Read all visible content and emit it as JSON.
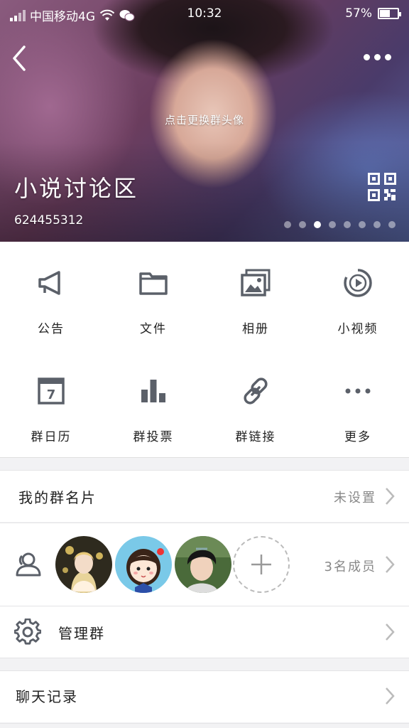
{
  "status_bar": {
    "carrier": "中国移动4G",
    "time": "10:32",
    "battery_percent": "57%",
    "battery_level": 0.57
  },
  "header": {
    "change_avatar_hint": "点击更换群头像",
    "group_name": "小说讨论区",
    "group_id": "624455312",
    "carousel_total": 8,
    "carousel_active": 3
  },
  "features": [
    {
      "label": "公告",
      "icon": "megaphone-icon"
    },
    {
      "label": "文件",
      "icon": "folder-icon"
    },
    {
      "label": "相册",
      "icon": "album-icon"
    },
    {
      "label": "小视频",
      "icon": "video-play-icon"
    },
    {
      "label": "群日历",
      "icon": "calendar-icon"
    },
    {
      "label": "群投票",
      "icon": "bar-chart-icon"
    },
    {
      "label": "群链接",
      "icon": "link-icon"
    },
    {
      "label": "更多",
      "icon": "more-dots-icon"
    }
  ],
  "my_card": {
    "label": "我的群名片",
    "value": "未设置"
  },
  "members": {
    "count_label": "3名成员"
  },
  "manage": {
    "label": "管理群"
  },
  "chat_history": {
    "label": "聊天记录"
  },
  "colors": {
    "icon_gray": "#5b6069",
    "text_primary": "#222222",
    "text_secondary": "#888888",
    "background": "#f2f2f4"
  }
}
